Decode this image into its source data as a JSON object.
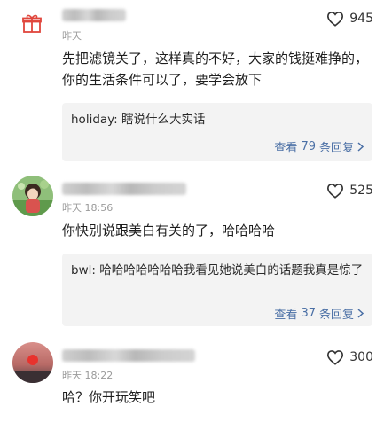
{
  "comments": [
    {
      "timestamp": "昨天",
      "likes": "945",
      "text": "先把滤镜关了，这样真的不好，大家的钱挺难挣的，你的生活条件可以了，要学会放下",
      "reply": {
        "author": "holiday",
        "text": "瞎说什么大实话"
      },
      "view_prefix": "查看",
      "view_count": "79",
      "view_suffix": "条回复"
    },
    {
      "timestamp": "昨天 18:56",
      "likes": "525",
      "text": "你快别说跟美白有关的了，哈哈哈哈",
      "reply": {
        "author": "bwl",
        "text": "哈哈哈哈哈哈哈我看见她说美白的话题我真是惊了"
      },
      "view_prefix": "查看",
      "view_count": "37",
      "view_suffix": "条回复"
    },
    {
      "timestamp": "昨天 18:22",
      "likes": "300",
      "text": "哈？你开玩笑吧"
    }
  ],
  "colors": {
    "link": "#4a6fa5",
    "reply_bg": "#f3f3f3",
    "gift": "#e0463c"
  }
}
